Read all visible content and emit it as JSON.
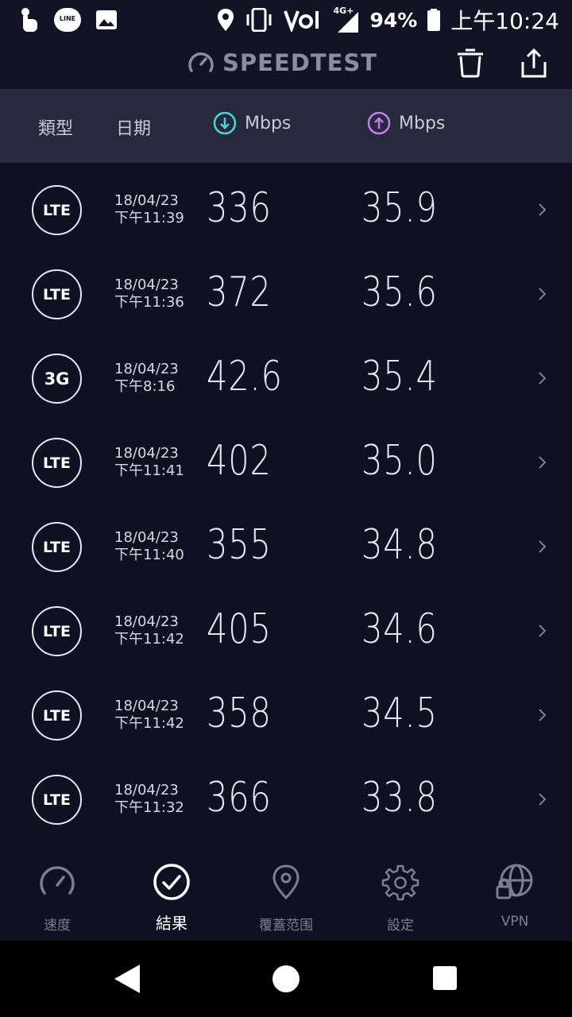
{
  "status_bar": {
    "left_icons": [
      "touch-icon",
      "line-app-icon",
      "image-icon"
    ],
    "line_label": "LINE",
    "right_icons": [
      "location-icon",
      "vibrate-icon",
      "volte-icon",
      "signal-icon",
      "battery-icon"
    ],
    "network": "4G+",
    "battery": "94%",
    "time": "上午10:24"
  },
  "header": {
    "logo_text": "SPEEDTEST",
    "actions": [
      "trash-icon",
      "share-icon"
    ]
  },
  "columns": {
    "type": "類型",
    "date": "日期",
    "download_unit": "Mbps",
    "upload_unit": "Mbps",
    "download_color": "#4fd1d9",
    "upload_color": "#c67bf0"
  },
  "results": [
    {
      "type": "LTE",
      "date": "18/04/23",
      "time": "下午11:39",
      "download": "336",
      "upload": "35.9"
    },
    {
      "type": "LTE",
      "date": "18/04/23",
      "time": "下午11:36",
      "download": "372",
      "upload": "35.6"
    },
    {
      "type": "3G",
      "date": "18/04/23",
      "time": "下午8:16",
      "download": "42.6",
      "upload": "35.4"
    },
    {
      "type": "LTE",
      "date": "18/04/23",
      "time": "下午11:41",
      "download": "402",
      "upload": "35.0"
    },
    {
      "type": "LTE",
      "date": "18/04/23",
      "time": "下午11:40",
      "download": "355",
      "upload": "34.8"
    },
    {
      "type": "LTE",
      "date": "18/04/23",
      "time": "下午11:42",
      "download": "405",
      "upload": "34.6"
    },
    {
      "type": "LTE",
      "date": "18/04/23",
      "time": "下午11:42",
      "download": "358",
      "upload": "34.5"
    },
    {
      "type": "LTE",
      "date": "18/04/23",
      "time": "下午11:32",
      "download": "366",
      "upload": "33.8"
    }
  ],
  "tabs": [
    {
      "label": "速度",
      "icon": "speedometer-icon",
      "active": false
    },
    {
      "label": "結果",
      "icon": "check-circle-icon",
      "active": true
    },
    {
      "label": "覆蓋范围",
      "icon": "map-pin-icon",
      "active": false
    },
    {
      "label": "設定",
      "icon": "gear-icon",
      "active": false
    },
    {
      "label": "VPN",
      "icon": "vpn-globe-lock-icon",
      "active": false
    }
  ],
  "nav": [
    "back-icon",
    "home-icon",
    "recents-icon"
  ]
}
